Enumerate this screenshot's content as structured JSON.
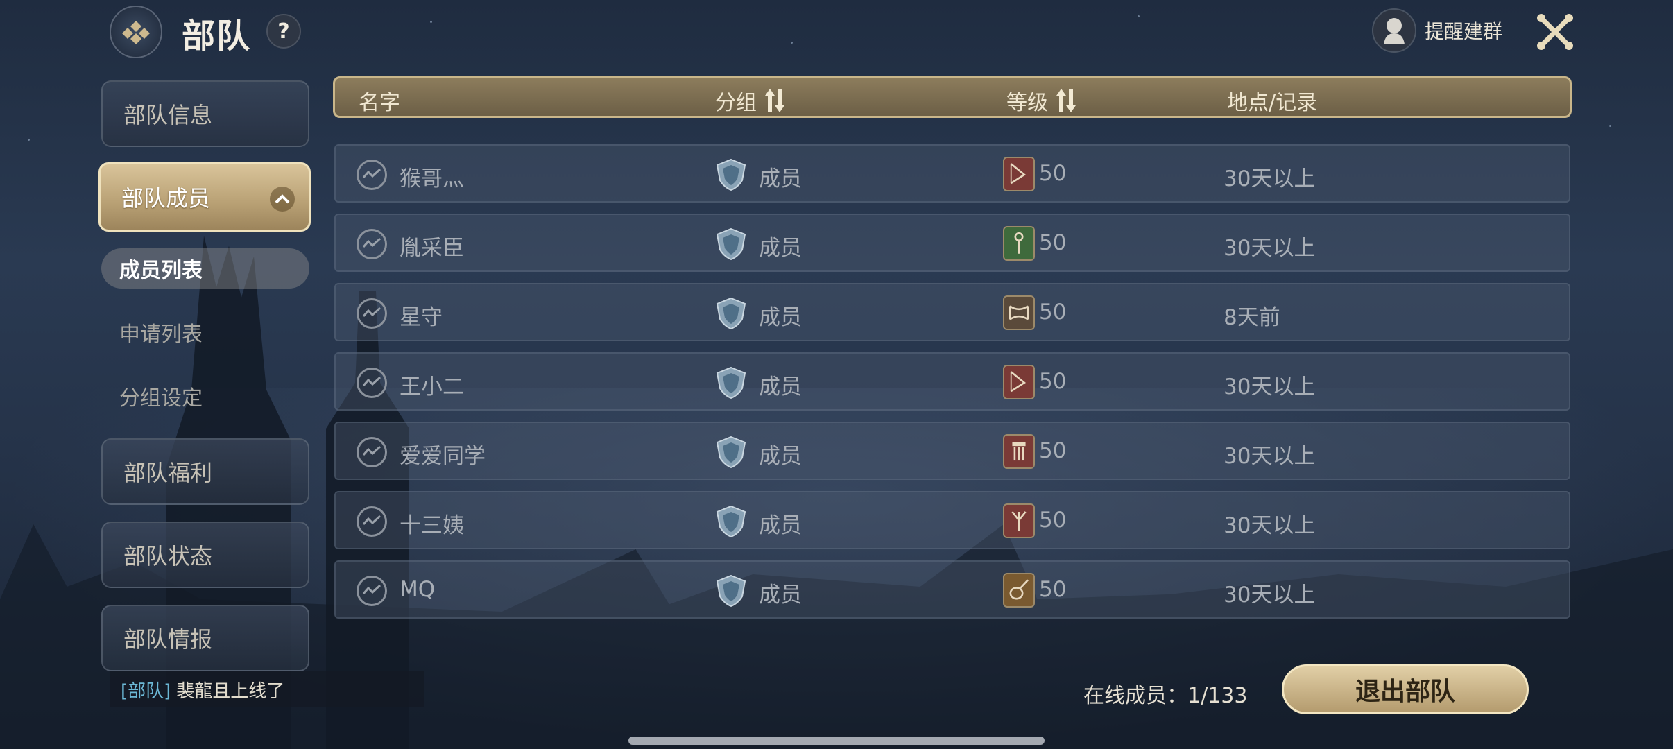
{
  "header": {
    "title": "部队",
    "help_label": "?",
    "remind_label": "提醒建群"
  },
  "sidebar": {
    "items": [
      {
        "label": "部队信息"
      },
      {
        "label": "部队成员",
        "active": true
      },
      {
        "label": "部队福利"
      },
      {
        "label": "部队状态"
      },
      {
        "label": "部队情报"
      }
    ],
    "subitems": [
      {
        "label": "成员列表",
        "active": true
      },
      {
        "label": "申请列表"
      },
      {
        "label": "分组设定"
      }
    ]
  },
  "table": {
    "columns": {
      "name": "名字",
      "group": "分组",
      "level": "等级",
      "location": "地点/记录"
    },
    "rows": [
      {
        "name": "猴哥灬",
        "group": "成员",
        "class_icon": "bow-icon",
        "level": "50",
        "record": "30天以上",
        "class_color": "#7a3a36"
      },
      {
        "name": "胤采臣",
        "group": "成员",
        "class_icon": "staff-icon",
        "level": "50",
        "record": "30天以上",
        "class_color": "#3f6a3c"
      },
      {
        "name": "星守",
        "group": "成员",
        "class_icon": "star-guard-icon",
        "level": "50",
        "record": "8天前",
        "class_color": "#5a4a3a"
      },
      {
        "name": "王小二",
        "group": "成员",
        "class_icon": "bow-icon",
        "level": "50",
        "record": "30天以上",
        "class_color": "#7a3a36"
      },
      {
        "name": "爱爱同学",
        "group": "成员",
        "class_icon": "pillar-icon",
        "level": "50",
        "record": "30天以上",
        "class_color": "#7a3a36"
      },
      {
        "name": "十三姨",
        "group": "成员",
        "class_icon": "trident-icon",
        "level": "50",
        "record": "30天以上",
        "class_color": "#7a3a36"
      },
      {
        "name": "MQ",
        "group": "成员",
        "class_icon": "lute-icon",
        "level": "50",
        "record": "30天以上",
        "class_color": "#7a5a30"
      }
    ]
  },
  "footer": {
    "message_tag": "[部队]",
    "message_text": "裴龍且上线了",
    "online_label": "在线成员：1/133",
    "exit_label": "退出部队"
  }
}
